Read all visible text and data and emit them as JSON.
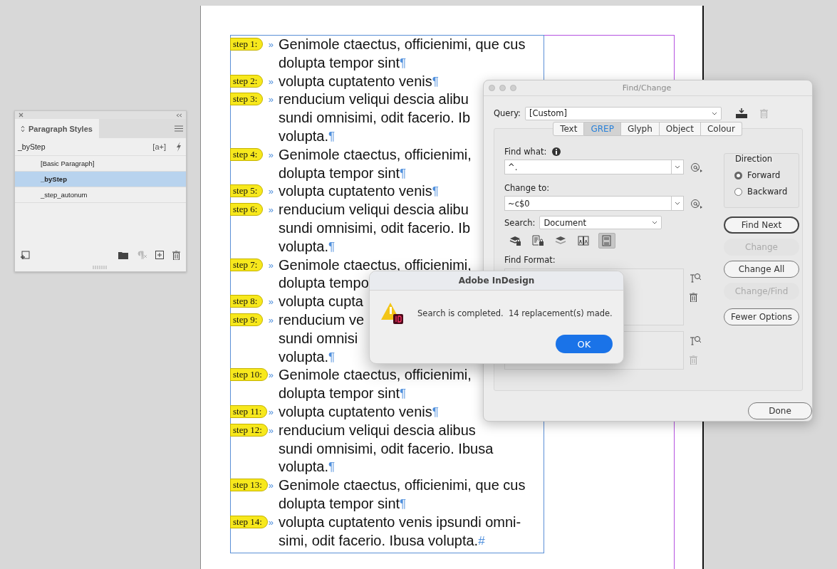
{
  "document": {
    "paragraphs": [
      {
        "step": "step 1:",
        "tab_mark": "»",
        "lines": [
          "Genimole ctaectus, officienimi, que cus",
          "dolupta tempor sint"
        ],
        "end_mark": "¶"
      },
      {
        "step": "step 2:",
        "tab_mark": "»",
        "lines": [
          "volupta cuptatento venis"
        ],
        "end_mark": "¶"
      },
      {
        "step": "step 3:",
        "tab_mark": "»",
        "lines": [
          "renducium veliqui descia alibu",
          "sundi omnisimi, odit facerio. Ib",
          "volupta."
        ],
        "end_mark": "¶"
      },
      {
        "step": "step 4:",
        "tab_mark": "»",
        "lines": [
          "Genimole ctaectus, officienimi,",
          "dolupta tempor sint"
        ],
        "end_mark": "¶"
      },
      {
        "step": "step 5:",
        "tab_mark": "»",
        "lines": [
          "volupta cuptatento venis"
        ],
        "end_mark": "¶"
      },
      {
        "step": "step 6:",
        "tab_mark": "»",
        "lines": [
          "renducium veliqui descia alibu",
          "sundi omnisimi, odit facerio. Ib",
          "volupta."
        ],
        "end_mark": "¶"
      },
      {
        "step": "step 7:",
        "tab_mark": "»",
        "lines": [
          "Genimole ctaectus, officienimi,",
          "dolupta tempo"
        ]
      },
      {
        "step": "step 8:",
        "tab_mark": "»",
        "lines": [
          "volupta cupta"
        ]
      },
      {
        "step": "step 9:",
        "tab_mark": "»",
        "lines": [
          "renducium ve",
          "sundi omnisi",
          "volupta."
        ],
        "end_mark": "¶"
      },
      {
        "step": "step 10:",
        "tab_mark": "»",
        "lines": [
          "Genimole ctaectus, officienimi,",
          "dolupta tempor sint"
        ],
        "end_mark": "¶"
      },
      {
        "step": "step 11:",
        "tab_mark": "»",
        "lines": [
          "volupta cuptatento venis"
        ],
        "end_mark": "¶"
      },
      {
        "step": "step 12:",
        "tab_mark": "»",
        "lines": [
          "renducium veliqui descia alibus",
          "sundi omnisimi, odit facerio. Ibusa",
          "volupta."
        ],
        "end_mark": "¶"
      },
      {
        "step": "step 13:",
        "tab_mark": "»",
        "lines": [
          "Genimole ctaectus, officienimi, que cus",
          "dolupta tempor sint"
        ],
        "end_mark": "¶"
      },
      {
        "step": "step 14:",
        "tab_mark": "»",
        "lines": [
          "volupta cuptatento venis ipsundi omni-",
          "simi, odit facerio. Ibusa volupta."
        ],
        "end_mark": "#"
      }
    ]
  },
  "paragraph_styles_panel": {
    "tab": "Paragraph Styles",
    "current_style": "_byStep",
    "override_label": "[a+]",
    "styles": [
      {
        "label": "[Basic Paragraph]",
        "selected": false
      },
      {
        "label": "_byStep",
        "selected": true
      },
      {
        "label": "_step_autonum",
        "selected": false
      }
    ]
  },
  "find_change": {
    "title": "Find/Change",
    "query_label": "Query:",
    "query": "[Custom]",
    "tabs": [
      {
        "label": "Text",
        "selected": false
      },
      {
        "label": "GREP",
        "selected": true
      },
      {
        "label": "Glyph",
        "selected": false
      },
      {
        "label": "Object",
        "selected": false
      },
      {
        "label": "Colour",
        "selected": false
      }
    ],
    "find_what_label": "Find what:",
    "find_what": "^.",
    "change_to_label": "Change to:",
    "change_to": "~c$0",
    "search_label": "Search:",
    "search": "Document",
    "option_icons": [
      {
        "kind": "locked-layers",
        "selected": false
      },
      {
        "kind": "locked-stories",
        "selected": false
      },
      {
        "kind": "hidden-layers",
        "selected": false
      },
      {
        "kind": "master-pages",
        "selected": false
      },
      {
        "kind": "footnotes",
        "selected": true
      }
    ],
    "find_format_label": "Find Format:",
    "direction": {
      "title": "Direction",
      "options": [
        {
          "label": "Forward",
          "selected": true
        },
        {
          "label": "Backward",
          "selected": false
        }
      ]
    },
    "buttons": [
      {
        "label": "Find Next",
        "default": true,
        "disabled": false
      },
      {
        "label": "Change",
        "default": false,
        "disabled": true
      },
      {
        "label": "Change All",
        "default": false,
        "disabled": false
      },
      {
        "label": "Change/Find",
        "default": false,
        "disabled": true
      },
      {
        "label": "Fewer Options",
        "default": false,
        "disabled": false
      }
    ],
    "done": "Done"
  },
  "alert": {
    "title": "Adobe InDesign",
    "message": "Search is completed.  14 replacement(s) made.",
    "button": "OK"
  }
}
